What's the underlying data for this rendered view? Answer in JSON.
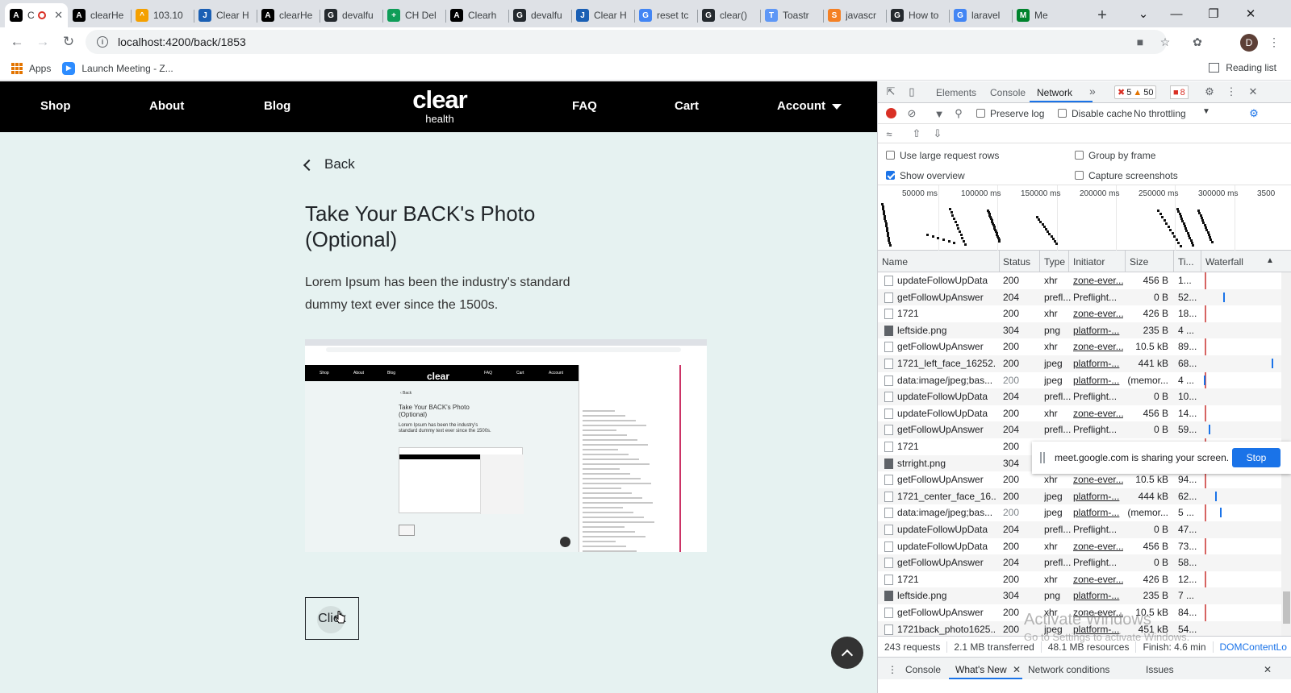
{
  "browser": {
    "tabs": [
      {
        "title": "C",
        "favicon": "A",
        "color": "#000000",
        "active": true
      },
      {
        "title": "clearHe",
        "favicon": "A",
        "color": "#000000"
      },
      {
        "title": "103.10",
        "favicon": "^",
        "color": "#f4a000"
      },
      {
        "title": "Clear H",
        "favicon": "J",
        "color": "#1a5fb4"
      },
      {
        "title": "clearHe",
        "favicon": "A",
        "color": "#000000"
      },
      {
        "title": "devalfu",
        "favicon": "G",
        "color": "#24292e"
      },
      {
        "title": "CH Del",
        "favicon": "+",
        "color": "#0f9d58"
      },
      {
        "title": "Clearh",
        "favicon": "A",
        "color": "#000000"
      },
      {
        "title": "devalfu",
        "favicon": "G",
        "color": "#24292e"
      },
      {
        "title": "Clear H",
        "favicon": "J",
        "color": "#1a5fb4"
      },
      {
        "title": "reset tc",
        "favicon": "G",
        "color": "#4285f4"
      },
      {
        "title": "clear()",
        "favicon": "G",
        "color": "#24292e"
      },
      {
        "title": "Toastr",
        "favicon": "T",
        "color": "#5e97f6"
      },
      {
        "title": "javascr",
        "favicon": "S",
        "color": "#f48024"
      },
      {
        "title": "How to",
        "favicon": "G",
        "color": "#24292e"
      },
      {
        "title": "laravel",
        "favicon": "G",
        "color": "#4285f4"
      },
      {
        "title": "Me",
        "favicon": "M",
        "color": "#00832d"
      }
    ],
    "url": "localhost:4200/back/1853",
    "profile_initial": "D",
    "bookmarks": {
      "apps": "Apps",
      "launch": "Launch Meeting - Z...",
      "reading_list": "Reading list"
    }
  },
  "site": {
    "nav": {
      "shop": "Shop",
      "about": "About",
      "blog": "Blog",
      "logo_main": "clear",
      "logo_sub": "health",
      "faq": "FAQ",
      "cart": "Cart",
      "account": "Account"
    },
    "back": "Back",
    "heading": "Take Your BACK's Photo (Optional)",
    "description": "Lorem Ipsum has been the industry's standard dummy text ever since the 1500s.",
    "button": "Click"
  },
  "devtools": {
    "tabs": [
      "Elements",
      "Console",
      "Network"
    ],
    "more": "»",
    "errors": "5",
    "warnings": "50",
    "issues": "8",
    "preserve_log": "Preserve log",
    "disable_cache": "Disable cache",
    "throttling": "No throttling",
    "options": {
      "large_rows": "Use large request rows",
      "group_frame": "Group by frame",
      "show_overview": "Show overview",
      "capture": "Capture screenshots"
    },
    "overview_ticks": [
      "50000 ms",
      "100000 ms",
      "150000 ms",
      "200000 ms",
      "250000 ms",
      "300000 ms",
      "3500"
    ],
    "columns": [
      "Name",
      "Status",
      "Type",
      "Initiator",
      "Size",
      "Ti...",
      "Waterfall"
    ],
    "rows": [
      {
        "name": "updateFollowUpData",
        "status": "200",
        "type": "xhr",
        "initiator": "zone-ever...",
        "size": "456 B",
        "time": "1..."
      },
      {
        "name": "getFollowUpAnswer",
        "status": "204",
        "type": "prefl...",
        "initiator": "Preflight...",
        "size": "0 B",
        "time": "52..."
      },
      {
        "name": "1721",
        "status": "200",
        "type": "xhr",
        "initiator": "zone-ever...",
        "size": "426 B",
        "time": "18..."
      },
      {
        "name": "leftside.png",
        "status": "304",
        "type": "png",
        "initiator": "platform-...",
        "size": "235 B",
        "time": "4 ..."
      },
      {
        "name": "getFollowUpAnswer",
        "status": "200",
        "type": "xhr",
        "initiator": "zone-ever...",
        "size": "10.5 kB",
        "time": "89..."
      },
      {
        "name": "1721_left_face_16252...",
        "status": "200",
        "type": "jpeg",
        "initiator": "platform-...",
        "size": "441 kB",
        "time": "68..."
      },
      {
        "name": "data:image/jpeg;bas...",
        "status": "200",
        "type": "jpeg",
        "initiator": "platform-...",
        "size": "(memor...",
        "time": "4 ..."
      },
      {
        "name": "updateFollowUpData",
        "status": "204",
        "type": "prefl...",
        "initiator": "Preflight...",
        "size": "0 B",
        "time": "10..."
      },
      {
        "name": "updateFollowUpData",
        "status": "200",
        "type": "xhr",
        "initiator": "zone-ever...",
        "size": "456 B",
        "time": "14..."
      },
      {
        "name": "getFollowUpAnswer",
        "status": "204",
        "type": "prefl...",
        "initiator": "Preflight...",
        "size": "0 B",
        "time": "59..."
      },
      {
        "name": "1721",
        "status": "200",
        "type": "xhr",
        "initiator": "",
        "size": "",
        "time": ""
      },
      {
        "name": "strright.png",
        "status": "304",
        "type": "pn",
        "initiator": "",
        "size": "",
        "time": ""
      },
      {
        "name": "getFollowUpAnswer",
        "status": "200",
        "type": "xhr",
        "initiator": "zone-ever...",
        "size": "10.5 kB",
        "time": "94..."
      },
      {
        "name": "1721_center_face_16...",
        "status": "200",
        "type": "jpeg",
        "initiator": "platform-...",
        "size": "444 kB",
        "time": "62..."
      },
      {
        "name": "data:image/jpeg;bas...",
        "status": "200",
        "type": "jpeg",
        "initiator": "platform-...",
        "size": "(memor...",
        "time": "5 ..."
      },
      {
        "name": "updateFollowUpData",
        "status": "204",
        "type": "prefl...",
        "initiator": "Preflight...",
        "size": "0 B",
        "time": "47..."
      },
      {
        "name": "updateFollowUpData",
        "status": "200",
        "type": "xhr",
        "initiator": "zone-ever...",
        "size": "456 B",
        "time": "73..."
      },
      {
        "name": "getFollowUpAnswer",
        "status": "204",
        "type": "prefl...",
        "initiator": "Preflight...",
        "size": "0 B",
        "time": "58..."
      },
      {
        "name": "1721",
        "status": "200",
        "type": "xhr",
        "initiator": "zone-ever...",
        "size": "426 B",
        "time": "12..."
      },
      {
        "name": "leftside.png",
        "status": "304",
        "type": "png",
        "initiator": "platform-...",
        "size": "235 B",
        "time": "7 ..."
      },
      {
        "name": "getFollowUpAnswer",
        "status": "200",
        "type": "xhr",
        "initiator": "zone-ever...",
        "size": "10.5 kB",
        "time": "84..."
      },
      {
        "name": "1721back_photo1625...",
        "status": "200",
        "type": "jpeg",
        "initiator": "platform-...",
        "size": "451 kB",
        "time": "54..."
      }
    ],
    "status": {
      "requests": "243 requests",
      "transferred": "2.1 MB transferred",
      "resources": "48.1 MB resources",
      "finish": "Finish: 4.6 min",
      "dcl": "DOMContentLo"
    },
    "drawer_tabs": [
      "Console",
      "What's New",
      "Network conditions",
      "Issues"
    ]
  },
  "share_bar": {
    "message": "meet.google.com is sharing your screen.",
    "stop": "Stop"
  },
  "watermark": {
    "line1": "Activate Windows",
    "line2": "Go to Settings to activate Windows."
  }
}
